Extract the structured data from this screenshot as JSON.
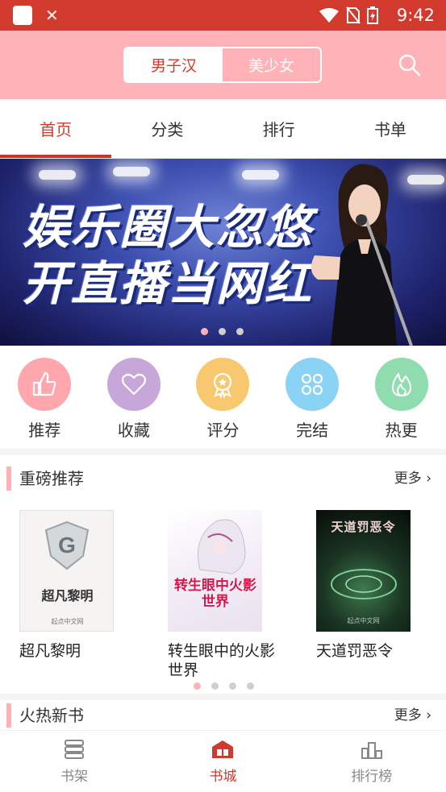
{
  "status_bar": {
    "time": "9:42"
  },
  "header": {
    "gender_options": [
      "男子汉",
      "美少女"
    ],
    "active_gender": "男子汉"
  },
  "tabs": [
    {
      "label": "首页",
      "active": true
    },
    {
      "label": "分类",
      "active": false
    },
    {
      "label": "排行",
      "active": false
    },
    {
      "label": "书单",
      "active": false
    }
  ],
  "banner": {
    "line1": "娱乐圈大忽悠",
    "line2": "开直播当网红",
    "slide_count": 3,
    "current_slide": 1
  },
  "quick_links": [
    {
      "label": "推荐",
      "icon": "thumbs-up-icon",
      "color": "#ffa7ad"
    },
    {
      "label": "收藏",
      "icon": "heart-icon",
      "color": "#c7a6d9"
    },
    {
      "label": "评分",
      "icon": "medal-icon",
      "color": "#f7c86e"
    },
    {
      "label": "完结",
      "icon": "clover-icon",
      "color": "#8ad3f5"
    },
    {
      "label": "热更",
      "icon": "flame-icon",
      "color": "#8fdcae"
    }
  ],
  "featured": {
    "title": "重磅推荐",
    "more": "更多",
    "books": [
      {
        "title": "超凡黎明",
        "cover_text": "超凡黎明",
        "cover_sub": "起点中文网"
      },
      {
        "title": "转生眼中的火影世界",
        "cover_text": "转生眼中火影世界",
        "cover_sub": ""
      },
      {
        "title": "天道罚恶令",
        "cover_text": "天道罚恶令",
        "cover_sub": "起点中文网"
      }
    ],
    "page_count": 4,
    "current_page": 1
  },
  "new_books": {
    "title": "火热新书",
    "more": "更多"
  },
  "bottom_nav": [
    {
      "label": "书架",
      "active": false,
      "icon": "bookshelf-icon"
    },
    {
      "label": "书城",
      "active": true,
      "icon": "bookstore-icon"
    },
    {
      "label": "排行榜",
      "active": false,
      "icon": "ranking-icon"
    }
  ],
  "colors": {
    "brand_red": "#d13a2c",
    "pink": "#ffb2b7"
  }
}
